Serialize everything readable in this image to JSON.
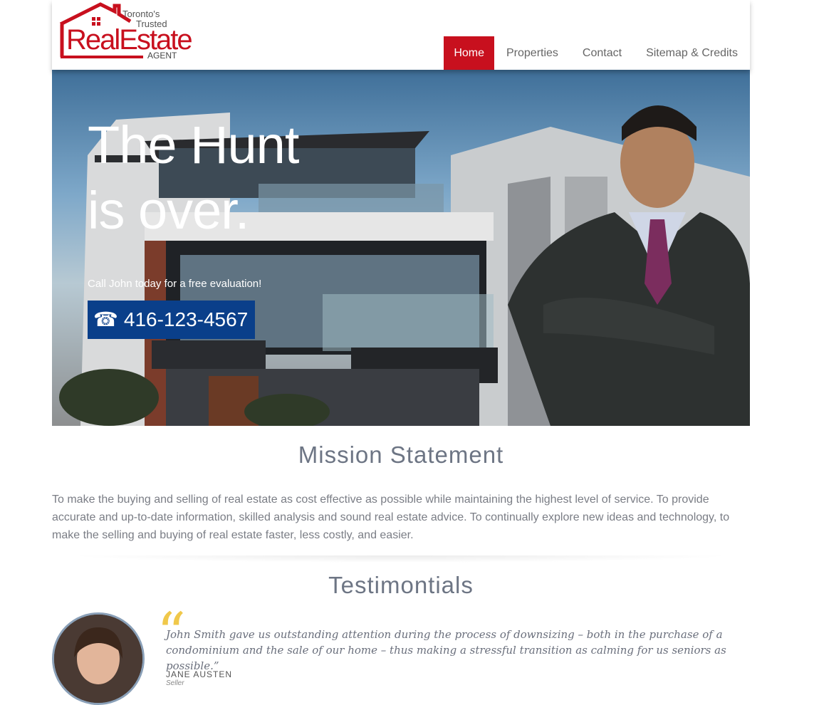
{
  "logo": {
    "tagline_line1": "Toronto's",
    "tagline_line2": "Trusted",
    "word1": "Real",
    "word2": "Estate",
    "word3": "AGENT",
    "icon": "house-roof-icon"
  },
  "nav": {
    "items": [
      {
        "label": "Home",
        "active": true
      },
      {
        "label": "Properties",
        "active": false
      },
      {
        "label": "Contact",
        "active": false
      },
      {
        "label": "Sitemap & Credits",
        "active": false
      }
    ]
  },
  "hero": {
    "headline_line1": "The Hunt",
    "headline_line2": "is over.",
    "cta_text": "Call John today for a free evaluation!",
    "phone_icon": "☎",
    "phone": "416-123-4567"
  },
  "mission": {
    "title": "Mission Statement",
    "text": "To make the buying and selling of real estate as cost effective as possible while maintaining the highest level of service. To provide accurate and up-to-date information, skilled analysis and sound real estate advice. To continually explore new ideas and technology, to make the selling and buying of real estate faster, less costly, and easier."
  },
  "testimonials": {
    "title": "Testimontials",
    "items": [
      {
        "quote": "John Smith gave us outstanding attention during the process of downsizing – both in the purchase of a condominium and the sale of our home – thus making a stressful transition as calming for us seniors as possible.”",
        "author": "JANE AUSTEN",
        "role": "Seller"
      }
    ]
  },
  "colors": {
    "brand_red": "#c8101e",
    "phone_blue": "#0a3f8a",
    "heading_gray": "#6d7584",
    "quote_gold": "#f0c84a"
  }
}
